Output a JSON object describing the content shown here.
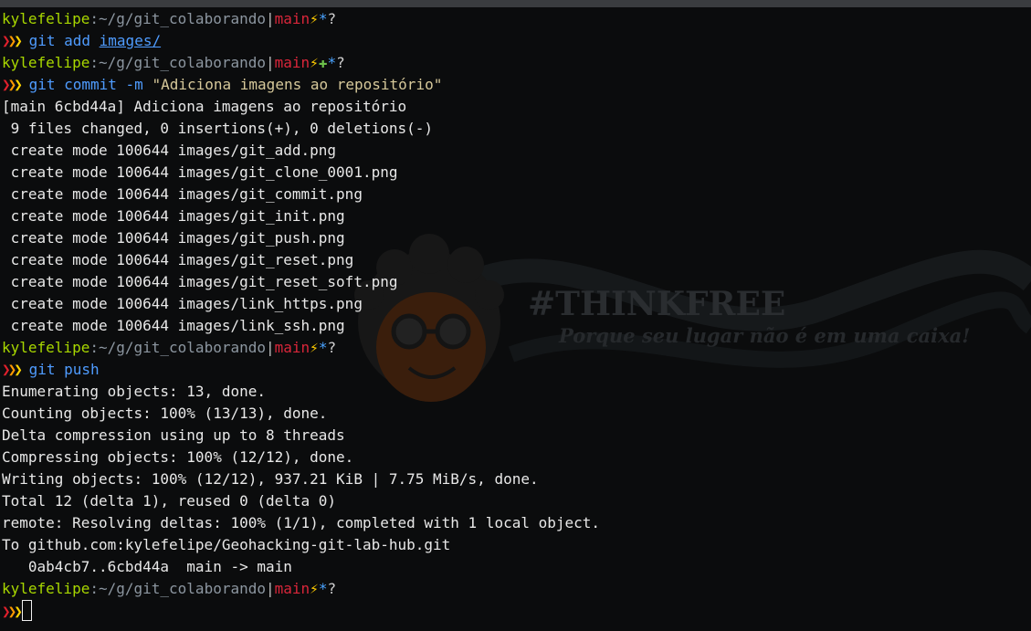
{
  "prompt": {
    "user": "kylefelipe",
    "colon": ":",
    "path": "~/g/git_colaborando",
    "separator": "|",
    "branch": "main",
    "bolt": "⚡",
    "plus": "✚",
    "star": "*",
    "question": "?",
    "arrows": "❯❯❯"
  },
  "commands": {
    "add": {
      "cmd": "git",
      "sub": "add",
      "arg": "images/"
    },
    "commit": {
      "cmd": "git",
      "sub": "commit",
      "flag": "-m",
      "message": "\"Adiciona imagens ao repositório\""
    },
    "push": {
      "cmd": "git",
      "sub": "push"
    }
  },
  "commit_output": [
    "[main 6cbd44a] Adiciona imagens ao repositório",
    " 9 files changed, 0 insertions(+), 0 deletions(-)",
    " create mode 100644 images/git_add.png",
    " create mode 100644 images/git_clone_0001.png",
    " create mode 100644 images/git_commit.png",
    " create mode 100644 images/git_init.png",
    " create mode 100644 images/git_push.png",
    " create mode 100644 images/git_reset.png",
    " create mode 100644 images/git_reset_soft.png",
    " create mode 100644 images/link_https.png",
    " create mode 100644 images/link_ssh.png"
  ],
  "push_output": [
    "Enumerating objects: 13, done.",
    "Counting objects: 100% (13/13), done.",
    "Delta compression using up to 8 threads",
    "Compressing objects: 100% (12/12), done.",
    "Writing objects: 100% (12/12), 937.21 KiB | 7.75 MiB/s, done.",
    "Total 12 (delta 1), reused 0 (delta 0)",
    "remote: Resolving deltas: 100% (1/1), completed with 1 local object.",
    "To github.com:kylefelipe/Geohacking-git-lab-hub.git",
    "   0ab4cb7..6cbd44a  main -> main"
  ],
  "watermark": {
    "title": "#THINKFREE",
    "subtitle": "Porque seu lugar não é em uma caixa!"
  },
  "colors": {
    "background": "#0b0c0d",
    "user": "#a8d700",
    "branch": "#d9263a",
    "command": "#4f9cff",
    "string": "#d6c89a"
  }
}
